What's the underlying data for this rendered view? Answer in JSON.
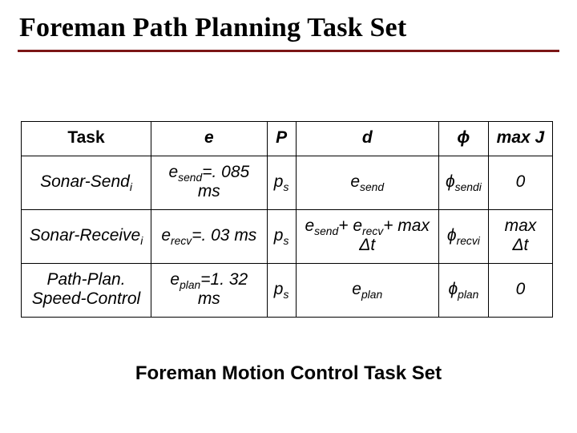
{
  "title": "Foreman Path Planning Task Set",
  "subtitle": "Foreman Motion Control Task Set",
  "table": {
    "headers": {
      "task": "Task",
      "e": "e",
      "P": "P",
      "d": "d",
      "phi": "ϕ",
      "maxJ": "max J"
    },
    "rows": [
      {
        "task_html": "Sonar-Send<sub>i</sub>",
        "e_html": "e<sub>send</sub>=. 085 ms",
        "P_html": "p<sub>s</sub>",
        "d_html": "e<sub>send</sub>",
        "phi_html": "ϕ<sub>sendi</sub>",
        "maxJ_html": "0"
      },
      {
        "task_html": "Sonar-Receive<sub>i</sub>",
        "e_html": "e<sub>recv</sub>=. 03 ms",
        "P_html": "p<sub>s</sub>",
        "d_html": "e<sub>send</sub>+ e<sub>recv</sub>+ max Δt",
        "phi_html": "ϕ<sub>recvi</sub>",
        "maxJ_html": "max Δt"
      },
      {
        "task_html": "Path-Plan.<br>Speed-Control",
        "e_html": "e<sub>plan</sub>=1. 32 ms",
        "P_html": "p<sub>s</sub>",
        "d_html": "e<sub>plan</sub>",
        "phi_html": "ϕ<sub>plan</sub>",
        "maxJ_html": "0"
      }
    ]
  },
  "chart_data": {
    "type": "table",
    "title": "Foreman Path Planning Task Set",
    "columns": [
      "Task",
      "e",
      "P",
      "d",
      "phi",
      "max J"
    ],
    "rows": [
      [
        "Sonar-Send_i",
        "e_send = 0.085 ms",
        "p_s",
        "e_send",
        "phi_send_i",
        "0"
      ],
      [
        "Sonar-Receive_i",
        "e_recv = 0.03 ms",
        "p_s",
        "e_send + e_recv + max Δt",
        "phi_recv_i",
        "max Δt"
      ],
      [
        "Path-Plan.Speed-Control",
        "e_plan = 1.32 ms",
        "p_s",
        "e_plan",
        "phi_plan",
        "0"
      ]
    ]
  }
}
